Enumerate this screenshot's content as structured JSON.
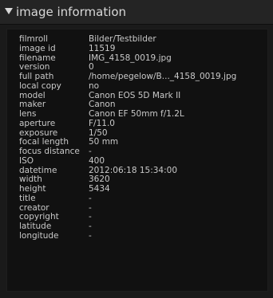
{
  "panel": {
    "title": "image information",
    "expanded_icon": "triangle-down-icon"
  },
  "rows": [
    {
      "key": "filmroll",
      "value": "Bilder/Testbilder"
    },
    {
      "key": "image id",
      "value": "11519"
    },
    {
      "key": "filename",
      "value": "IMG_4158_0019.jpg"
    },
    {
      "key": "version",
      "value": "0"
    },
    {
      "key": "full path",
      "value": "/home/pegelow/B..._4158_0019.jpg"
    },
    {
      "key": "local copy",
      "value": "no"
    },
    {
      "key": "model",
      "value": "Canon EOS 5D Mark II"
    },
    {
      "key": "maker",
      "value": "Canon"
    },
    {
      "key": "lens",
      "value": "Canon EF 50mm f/1.2L"
    },
    {
      "key": "aperture",
      "value": "F/11.0"
    },
    {
      "key": "exposure",
      "value": "1/50"
    },
    {
      "key": "focal length",
      "value": "50 mm"
    },
    {
      "key": "focus distance",
      "value": "-"
    },
    {
      "key": "ISO",
      "value": "400"
    },
    {
      "key": "datetime",
      "value": "2012:06:18 15:34:00"
    },
    {
      "key": "width",
      "value": "3620"
    },
    {
      "key": "height",
      "value": "5434"
    },
    {
      "key": "title",
      "value": "-"
    },
    {
      "key": "creator",
      "value": "-"
    },
    {
      "key": "copyright",
      "value": "-"
    },
    {
      "key": "latitude",
      "value": "-"
    },
    {
      "key": "longitude",
      "value": "-"
    }
  ]
}
